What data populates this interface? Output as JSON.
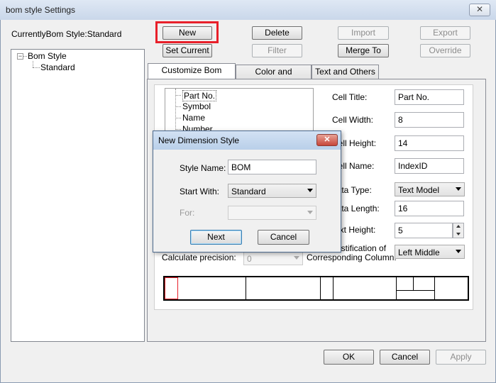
{
  "window": {
    "title": "bom style Settings",
    "close_glyph": "✕"
  },
  "current_style": "CurrentlyBom Style:Standard",
  "buttons": {
    "new": "New",
    "delete": "Delete",
    "import": "Import",
    "export": "Export",
    "set_current": "Set Current",
    "filter": "Filter",
    "merge_to": "Merge To",
    "override": "Override",
    "ok": "OK",
    "cancel": "Cancel",
    "apply": "Apply"
  },
  "tree": {
    "root": "Bom Style",
    "child": "Standard",
    "expander": "−"
  },
  "tabs": [
    "Customize Bom Header",
    "Color and Linewidth",
    "Text and Others"
  ],
  "fields_list": [
    "Part No.",
    "Symbol",
    "Name",
    "Number"
  ],
  "props": {
    "cell_title_label": "Cell Title:",
    "cell_title": "Part No.",
    "cell_width_label": "Cell Width:",
    "cell_width": "8",
    "cell_height_label": "Cell Height:",
    "cell_height": "14",
    "cell_name_label": "Cell Name:",
    "cell_name": "IndexID",
    "data_type_label": "Data Type:",
    "data_type": "Text Model",
    "data_length_label": "Data Length:",
    "data_length": "16",
    "text_height_label": "Text Height:",
    "text_height": "5",
    "justification_label_1": "Justification of",
    "justification_label_2": "Corresponding Column:",
    "justification": "Left Middle",
    "calc_precision_label": "Calculate precision:",
    "calc_precision": "0"
  },
  "dialog": {
    "title": "New Dimension Style",
    "style_name_label": "Style Name:",
    "style_name": "BOM",
    "start_with_label": "Start With:",
    "start_with": "Standard",
    "for_label": "For:",
    "for_value": "",
    "next": "Next",
    "cancel": "Cancel",
    "close_glyph": "✕"
  },
  "colors": {
    "highlight": "#e8202a",
    "accent": "#3c7fb1"
  }
}
